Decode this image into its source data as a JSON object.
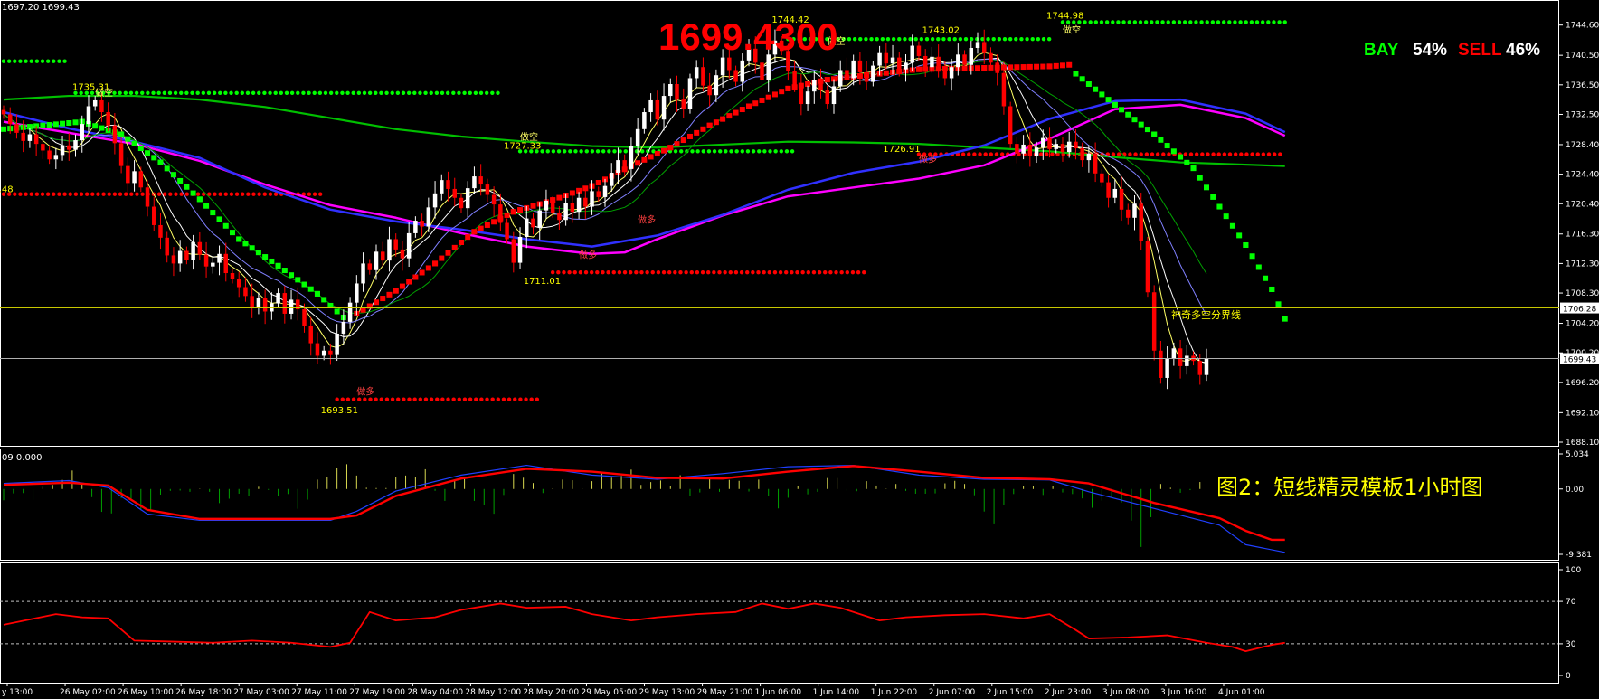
{
  "header": {
    "ohlc_text": "1697.20 1699.43",
    "big_price": "1699.4300",
    "bay_label": "BAY",
    "bay_pct": "54%",
    "sell_label": "SELL",
    "sell_pct": "46%"
  },
  "caption": "图2：短线精灵模板1小时图",
  "macd_header": "09 0.000",
  "boundary_label": "神奇多空分界线",
  "markers": {
    "bull": "做多",
    "bear": "做空"
  },
  "colors": {
    "up": "#ffffff",
    "down": "#ff0000",
    "bull_dots": "#00ff00",
    "bear_dots": "#ff0000",
    "ma_magenta": "#ff00ff",
    "ma_blue": "#3030ff",
    "ma_green": "#00c000",
    "yellow_line": "#c8c800",
    "axis_text": "#ffffff"
  },
  "chart_data": {
    "type": "candlestick",
    "instrument_price_last": 1699.43,
    "y_axis_ticks": [
      "1744.60",
      "1740.50",
      "1736.50",
      "1732.50",
      "1728.40",
      "1724.40",
      "1720.40",
      "1716.30",
      "1712.30",
      "1708.30",
      "1704.20",
      "1700.20",
      "1696.20",
      "1692.10",
      "1688.10"
    ],
    "ylim": [
      1688.1,
      1747.5
    ],
    "x_axis_ticks": [
      "y 13:00",
      "26 May 02:00",
      "26 May 10:00",
      "26 May 18:00",
      "27 May 03:00",
      "27 May 11:00",
      "27 May 19:00",
      "28 May 04:00",
      "28 May 12:00",
      "28 May 20:00",
      "29 May 05:00",
      "29 May 13:00",
      "29 May 21:00",
      "1 Jun 06:00",
      "1 Jun 14:00",
      "1 Jun 22:00",
      "2 Jun 07:00",
      "2 Jun 15:00",
      "2 Jun 23:00",
      "3 Jun 08:00",
      "3 Jun 16:00",
      "4 Jun 01:00"
    ],
    "current_price_label": "1699.43",
    "boundary_price_label": "1706.28",
    "boundary_price": 1706.28,
    "price_annotations": [
      {
        "text": "1735.31",
        "value": 1735.31,
        "bar": 13
      },
      {
        "text": "1727.33",
        "value": 1727.33,
        "bar": 79
      },
      {
        "text": "1711.01",
        "value": 1711.01,
        "bar": 82
      },
      {
        "text": "1693.51",
        "value": 1693.51,
        "bar": 51
      },
      {
        "text": "1744.42",
        "value": 1744.42,
        "bar": 120
      },
      {
        "text": "1743.02",
        "value": 1743.02,
        "bar": 143
      },
      {
        "text": "1744.98",
        "value": 1744.98,
        "bar": 162
      },
      {
        "text": "1726.91",
        "value": 1726.91,
        "bar": 137
      },
      {
        "text": "21.48",
        "value": 1721.48,
        "bar": 0
      }
    ],
    "close": [
      1732.5,
      1731.2,
      1730.0,
      1728.9,
      1729.8,
      1728.5,
      1727.6,
      1726.4,
      1727.0,
      1728.3,
      1727.7,
      1729.0,
      1731.2,
      1733.6,
      1734.4,
      1732.8,
      1731.0,
      1728.6,
      1725.5,
      1723.2,
      1724.8,
      1722.6,
      1720.0,
      1717.5,
      1715.8,
      1713.4,
      1712.3,
      1714.0,
      1712.8,
      1715.2,
      1713.5,
      1711.9,
      1712.4,
      1713.6,
      1711.0,
      1710.2,
      1709.1,
      1707.9,
      1706.4,
      1707.6,
      1705.8,
      1706.9,
      1708.3,
      1705.5,
      1707.4,
      1706.1,
      1703.9,
      1701.5,
      1699.8,
      1700.5,
      1699.9,
      1702.8,
      1704.4,
      1707.0,
      1709.6,
      1712.3,
      1711.4,
      1713.9,
      1712.7,
      1715.6,
      1714.2,
      1713.0,
      1716.4,
      1718.1,
      1717.3,
      1719.9,
      1721.8,
      1723.6,
      1722.4,
      1721.2,
      1719.8,
      1722.5,
      1724.1,
      1723.0,
      1721.6,
      1720.3,
      1717.8,
      1715.6,
      1712.4,
      1715.9,
      1718.4,
      1717.2,
      1719.5,
      1720.8,
      1719.1,
      1718.2,
      1720.5,
      1719.3,
      1721.2,
      1720.0,
      1722.1,
      1721.3,
      1722.8,
      1724.6,
      1726.3,
      1725.1,
      1728.2,
      1730.5,
      1732.8,
      1734.4,
      1731.8,
      1735.0,
      1736.6,
      1734.5,
      1733.2,
      1737.4,
      1738.9,
      1736.4,
      1735.1,
      1737.8,
      1740.2,
      1738.5,
      1736.9,
      1739.8,
      1741.4,
      1739.5,
      1737.2,
      1740.6,
      1742.5,
      1741.1,
      1738.4,
      1736.3,
      1733.9,
      1735.6,
      1737.2,
      1735.8,
      1733.9,
      1736.3,
      1738.5,
      1737.4,
      1739.8,
      1738.2,
      1736.9,
      1739.1,
      1740.8,
      1739.4,
      1740.2,
      1738.6,
      1739.5,
      1741.8,
      1740.4,
      1738.9,
      1740.3,
      1739.0,
      1737.4,
      1738.9,
      1740.6,
      1739.2,
      1741.5,
      1742.3,
      1740.8,
      1739.5,
      1738.1,
      1733.6,
      1728.5,
      1727.2,
      1728.4,
      1726.9,
      1728.0,
      1729.3,
      1727.8,
      1728.5,
      1727.4,
      1728.8,
      1727.9,
      1726.3,
      1727.2,
      1724.5,
      1723.3,
      1721.2,
      1722.4,
      1719.6,
      1718.5,
      1720.4,
      1715.3,
      1708.4,
      1700.5,
      1696.8,
      1699.4,
      1700.8,
      1698.4,
      1699.8,
      1699.1,
      1697.2,
      1699.43
    ],
    "ma_magenta": [
      [
        0,
        1731.5
      ],
      [
        10,
        1730.0
      ],
      [
        20,
        1728.5
      ],
      [
        30,
        1726.2
      ],
      [
        40,
        1723.0
      ],
      [
        50,
        1720.2
      ],
      [
        60,
        1718.5
      ],
      [
        70,
        1716.4
      ],
      [
        80,
        1714.6
      ],
      [
        90,
        1713.6
      ],
      [
        95,
        1713.8
      ],
      [
        100,
        1715.6
      ],
      [
        110,
        1718.8
      ],
      [
        120,
        1721.4
      ],
      [
        130,
        1722.6
      ],
      [
        140,
        1723.8
      ],
      [
        150,
        1725.6
      ],
      [
        160,
        1729.2
      ],
      [
        170,
        1733.2
      ],
      [
        180,
        1733.8
      ],
      [
        190,
        1732.0
      ],
      [
        196,
        1729.6
      ]
    ],
    "ma_blue": [
      [
        0,
        1732.8
      ],
      [
        10,
        1730.6
      ],
      [
        20,
        1728.8
      ],
      [
        30,
        1726.6
      ],
      [
        40,
        1722.6
      ],
      [
        50,
        1719.6
      ],
      [
        60,
        1718.0
      ],
      [
        70,
        1716.9
      ],
      [
        80,
        1715.6
      ],
      [
        90,
        1714.6
      ],
      [
        100,
        1716.1
      ],
      [
        110,
        1718.9
      ],
      [
        120,
        1722.3
      ],
      [
        130,
        1724.6
      ],
      [
        140,
        1726.1
      ],
      [
        150,
        1728.3
      ],
      [
        160,
        1731.9
      ],
      [
        170,
        1734.3
      ],
      [
        180,
        1734.5
      ],
      [
        190,
        1732.6
      ],
      [
        196,
        1730.1
      ]
    ],
    "ma_green": [
      [
        0,
        1734.5
      ],
      [
        10,
        1735.0
      ],
      [
        20,
        1735.0
      ],
      [
        30,
        1734.5
      ],
      [
        40,
        1733.5
      ],
      [
        50,
        1732.0
      ],
      [
        60,
        1730.5
      ],
      [
        70,
        1729.5
      ],
      [
        80,
        1728.8
      ],
      [
        90,
        1728.2
      ],
      [
        100,
        1728.0
      ],
      [
        110,
        1728.4
      ],
      [
        120,
        1728.8
      ],
      [
        130,
        1728.7
      ],
      [
        140,
        1728.5
      ],
      [
        150,
        1728.0
      ],
      [
        160,
        1727.5
      ],
      [
        170,
        1726.7
      ],
      [
        180,
        1726.0
      ],
      [
        196,
        1725.5
      ]
    ],
    "dot_lines": [
      {
        "kind": "bull",
        "value": 1745.0,
        "from": 162,
        "to": 196
      },
      {
        "kind": "bull",
        "value": 1742.7,
        "from": 120,
        "to": 160
      },
      {
        "kind": "bull",
        "value": 1739.7,
        "from": 0,
        "to": 10
      },
      {
        "kind": "bull",
        "value": 1735.4,
        "from": 11,
        "to": 76
      },
      {
        "kind": "bull",
        "value": 1727.5,
        "from": 79,
        "to": 121
      },
      {
        "kind": "bear",
        "value": 1727.1,
        "from": 140,
        "to": 196
      },
      {
        "kind": "bear",
        "value": 1721.7,
        "from": 0,
        "to": 49
      },
      {
        "kind": "bear",
        "value": 1711.1,
        "from": 84,
        "to": 132
      },
      {
        "kind": "bear",
        "value": 1693.9,
        "from": 51,
        "to": 82
      }
    ],
    "step_red": [
      [
        54,
        1705.5
      ],
      [
        60,
        1708.6
      ],
      [
        66,
        1712.3
      ],
      [
        72,
        1716.6
      ],
      [
        78,
        1719.3
      ],
      [
        84,
        1720.9
      ],
      [
        90,
        1722.8
      ],
      [
        96,
        1725.5
      ],
      [
        102,
        1728.0
      ],
      [
        108,
        1731.0
      ],
      [
        114,
        1733.6
      ],
      [
        120,
        1736.0
      ],
      [
        126,
        1737.2
      ],
      [
        132,
        1737.8
      ],
      [
        140,
        1738.6
      ],
      [
        150,
        1738.8
      ],
      [
        160,
        1739.0
      ],
      [
        163,
        1739.2
      ]
    ],
    "step_green": [
      [
        0,
        1730.5
      ],
      [
        12,
        1731.5
      ],
      [
        18,
        1729.8
      ],
      [
        24,
        1726.0
      ],
      [
        30,
        1721.0
      ],
      [
        36,
        1715.6
      ],
      [
        42,
        1712.0
      ],
      [
        48,
        1708.2
      ],
      [
        52,
        1705.0
      ],
      [
        164,
        1738.0
      ],
      [
        170,
        1733.8
      ],
      [
        176,
        1729.8
      ],
      [
        182,
        1725.2
      ],
      [
        186,
        1720.0
      ],
      [
        190,
        1714.8
      ],
      [
        194,
        1708.8
      ],
      [
        196,
        1704.8
      ]
    ],
    "macd": {
      "type": "line+histogram",
      "y_axis_ticks": [
        "5.034",
        "0.00",
        "-9.381"
      ],
      "ylim": [
        -9.381,
        5.034
      ],
      "signal_red": [
        [
          0,
          0.6
        ],
        [
          10,
          0.9
        ],
        [
          16,
          0.5
        ],
        [
          22,
          -3.0
        ],
        [
          30,
          -4.3
        ],
        [
          40,
          -4.3
        ],
        [
          50,
          -4.3
        ],
        [
          54,
          -3.8
        ],
        [
          60,
          -1.0
        ],
        [
          70,
          1.5
        ],
        [
          80,
          2.9
        ],
        [
          90,
          2.5
        ],
        [
          100,
          1.6
        ],
        [
          110,
          1.5
        ],
        [
          120,
          2.5
        ],
        [
          130,
          3.3
        ],
        [
          140,
          2.5
        ],
        [
          150,
          1.6
        ],
        [
          160,
          1.4
        ],
        [
          166,
          0.8
        ],
        [
          176,
          -2.0
        ],
        [
          186,
          -4.2
        ],
        [
          190,
          -6.0
        ],
        [
          194,
          -7.3
        ],
        [
          196,
          -7.3
        ]
      ],
      "macd_blue": [
        [
          0,
          0.8
        ],
        [
          10,
          1.2
        ],
        [
          16,
          0.2
        ],
        [
          22,
          -3.6
        ],
        [
          30,
          -4.5
        ],
        [
          40,
          -4.5
        ],
        [
          50,
          -4.5
        ],
        [
          54,
          -3.2
        ],
        [
          60,
          -0.3
        ],
        [
          70,
          2.0
        ],
        [
          80,
          3.4
        ],
        [
          90,
          2.0
        ],
        [
          100,
          1.4
        ],
        [
          110,
          2.2
        ],
        [
          120,
          3.2
        ],
        [
          130,
          3.4
        ],
        [
          140,
          2.0
        ],
        [
          150,
          1.4
        ],
        [
          160,
          1.3
        ],
        [
          166,
          -0.4
        ],
        [
          176,
          -2.8
        ],
        [
          186,
          -5.2
        ],
        [
          190,
          -8.0
        ],
        [
          196,
          -9.1
        ]
      ]
    },
    "rsi": {
      "type": "line",
      "y_axis_ticks": [
        "100",
        "70",
        "30",
        "0"
      ],
      "ylim": [
        0,
        100
      ],
      "levels": [
        70,
        30
      ],
      "values": [
        [
          0,
          48
        ],
        [
          4,
          53
        ],
        [
          8,
          58
        ],
        [
          12,
          55
        ],
        [
          16,
          54
        ],
        [
          20,
          33
        ],
        [
          26,
          32
        ],
        [
          32,
          31
        ],
        [
          38,
          33
        ],
        [
          44,
          31
        ],
        [
          50,
          27
        ],
        [
          53,
          31
        ],
        [
          56,
          60
        ],
        [
          60,
          52
        ],
        [
          66,
          55
        ],
        [
          70,
          62
        ],
        [
          76,
          68
        ],
        [
          80,
          64
        ],
        [
          86,
          65
        ],
        [
          90,
          58
        ],
        [
          96,
          52
        ],
        [
          100,
          55
        ],
        [
          106,
          58
        ],
        [
          112,
          60
        ],
        [
          116,
          68
        ],
        [
          120,
          63
        ],
        [
          124,
          68
        ],
        [
          128,
          64
        ],
        [
          134,
          52
        ],
        [
          138,
          55
        ],
        [
          144,
          57
        ],
        [
          150,
          58
        ],
        [
          156,
          54
        ],
        [
          160,
          58
        ],
        [
          164,
          43
        ],
        [
          166,
          35
        ],
        [
          172,
          36
        ],
        [
          178,
          38
        ],
        [
          184,
          31
        ],
        [
          188,
          27
        ],
        [
          190,
          23
        ],
        [
          194,
          29
        ],
        [
          196,
          31
        ]
      ]
    }
  }
}
